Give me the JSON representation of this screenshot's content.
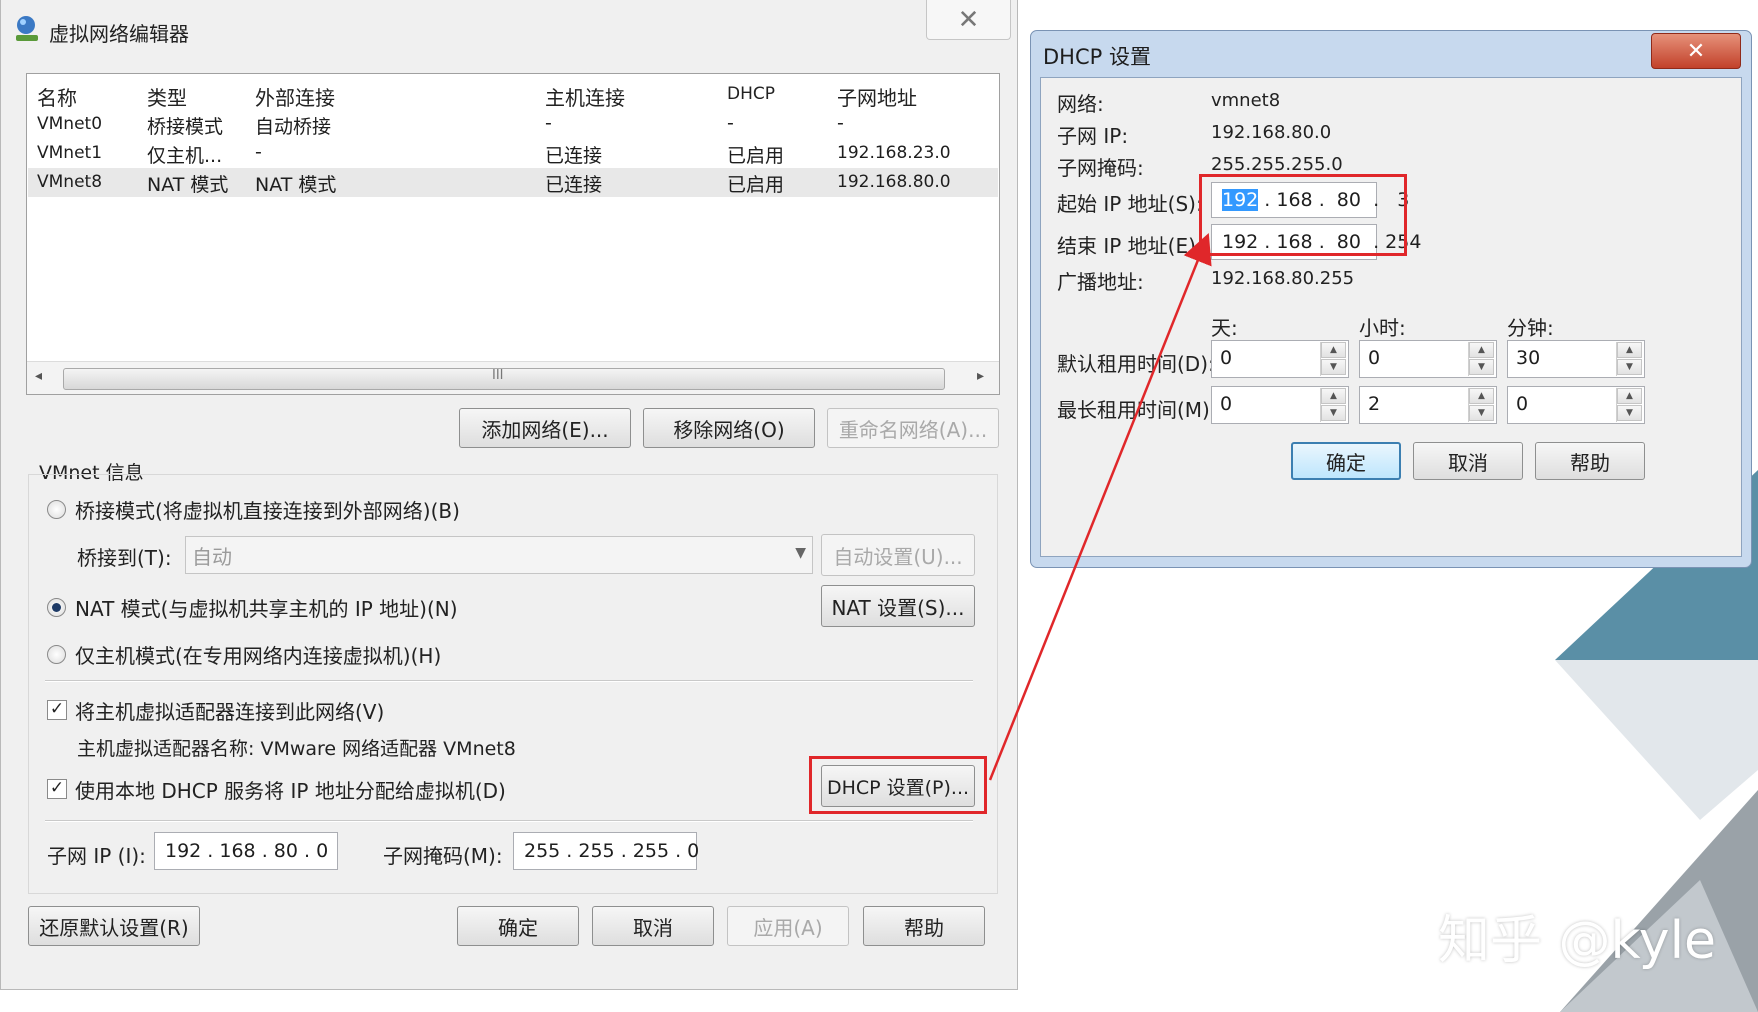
{
  "main_window": {
    "title": "虚拟网络编辑器",
    "close_glyph": "✕",
    "columns": [
      "名称",
      "类型",
      "外部连接",
      "主机连接",
      "DHCP",
      "子网地址"
    ],
    "rows": [
      {
        "name": "VMnet0",
        "type": "桥接模式",
        "external": "自动桥接",
        "host": "-",
        "dhcp": "-",
        "subnet": "-"
      },
      {
        "name": "VMnet1",
        "type": "仅主机...",
        "external": "-",
        "host": "已连接",
        "dhcp": "已启用",
        "subnet": "192.168.23.0"
      },
      {
        "name": "VMnet8",
        "type": "NAT 模式",
        "external": "NAT 模式",
        "host": "已连接",
        "dhcp": "已启用",
        "subnet": "192.168.80.0"
      }
    ],
    "selected_row": "VMnet8",
    "scroll_grip": "III",
    "buttons": {
      "add_network": "添加网络(E)...",
      "remove_network": "移除网络(O)",
      "rename_network": "重命名网络(A)..."
    },
    "vmnet_info": {
      "title": "VMnet 信息",
      "bridge_radio": "桥接模式(将虚拟机直接连接到外部网络)(B)",
      "bridge_to_label": "桥接到(T):",
      "bridge_to_value": "自动",
      "auto_settings": "自动设置(U)...",
      "nat_radio": "NAT 模式(与虚拟机共享主机的 IP 地址)(N)",
      "nat_settings": "NAT 设置(S)...",
      "host_only_radio": "仅主机模式(在专用网络内连接虚拟机)(H)",
      "selected_mode": "nat",
      "connect_adapter_checkbox": "将主机虚拟适配器连接到此网络(V)",
      "connect_adapter_checked": true,
      "adapter_name": "主机虚拟适配器名称: VMware 网络适配器 VMnet8",
      "dhcp_checkbox": "使用本地 DHCP 服务将 IP 地址分配给虚拟机(D)",
      "dhcp_checked": true,
      "dhcp_settings": "DHCP 设置(P)...",
      "subnet_ip_label": "子网 IP (I):",
      "subnet_ip_value": "192 . 168 .  80  .   0",
      "subnet_mask_label": "子网掩码(M):",
      "subnet_mask_value": "255 . 255 . 255 .   0"
    },
    "footer": {
      "restore": "还原默认设置(R)",
      "ok": "确定",
      "cancel": "取消",
      "apply": "应用(A)",
      "help": "帮助"
    }
  },
  "dhcp_dialog": {
    "title": "DHCP 设置",
    "close_glyph": "✕",
    "network_label": "网络:",
    "network_value": "vmnet8",
    "subnet_ip_label": "子网 IP:",
    "subnet_ip_value": "192.168.80.0",
    "subnet_mask_label": "子网掩码:",
    "subnet_mask_value": "255.255.255.0",
    "start_ip_label": "起始 IP 地址(S):",
    "start_ip_first": "192",
    "start_ip_rest": " . 168 .  80  .   3",
    "end_ip_label": "结束 IP 地址(E):",
    "end_ip_value": "192 . 168 .  80  . 254",
    "broadcast_label": "广播地址:",
    "broadcast_value": "192.168.80.255",
    "col_days": "天:",
    "col_hours": "小时:",
    "col_minutes": "分钟:",
    "default_lease_label": "默认租用时间(D):",
    "default_lease": {
      "days": "0",
      "hours": "0",
      "minutes": "30"
    },
    "max_lease_label": "最长租用时间(M):",
    "max_lease": {
      "days": "0",
      "hours": "2",
      "minutes": "0"
    },
    "ok": "确定",
    "cancel": "取消",
    "help": "帮助"
  },
  "watermark": "知乎 @kyle",
  "annotation_color": "#e0272a"
}
